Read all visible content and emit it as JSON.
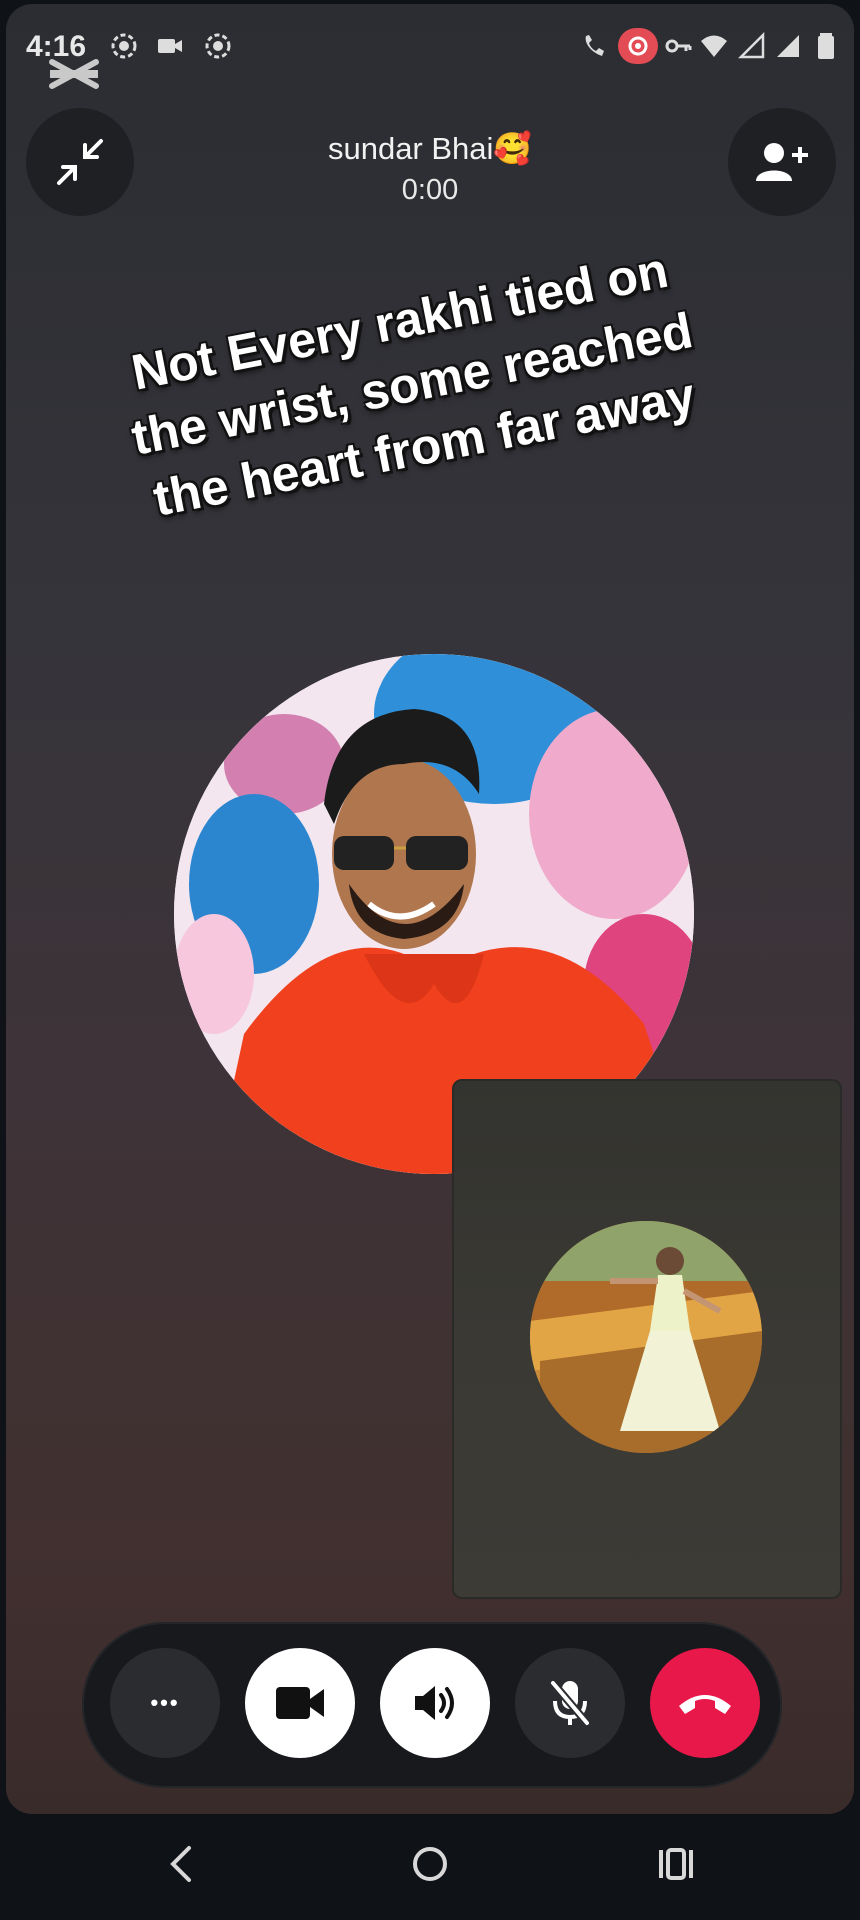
{
  "status_bar": {
    "time": "4:16"
  },
  "call": {
    "contact_name": "sundar Bhai🥰",
    "timer": "0:00"
  },
  "overlay": {
    "caption": "Not Every rakhi tied on the wrist, some reached the heart from far away"
  },
  "controls": {
    "more": "•••"
  },
  "colors": {
    "end_call": "#e8194a",
    "white_button": "#ffffff",
    "dark_button": "#2a2c30"
  }
}
